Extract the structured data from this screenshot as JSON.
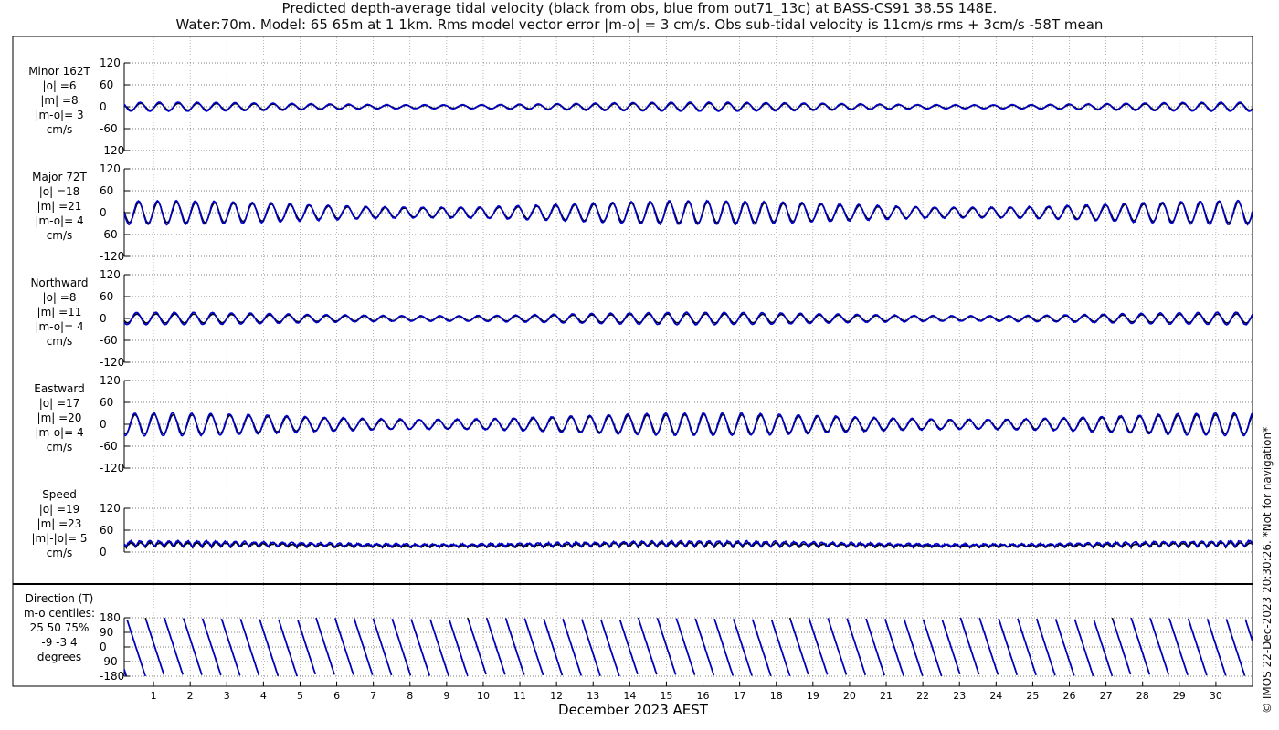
{
  "title": {
    "line1": "Predicted depth-average tidal velocity (black from obs, blue from out71_13c) at BASS-CS91 38.5S 148E.",
    "line2": "Water:70m. Model: 65 65m at 1 1km. Rms model vector error |m-o| = 3 cm/s. Obs sub-tidal velocity is 11cm/s rms + 3cm/s -58T mean"
  },
  "credit": "© IMOS 22-Dec-2023 20:30:26. *Not for navigation*",
  "colors": {
    "obs": "#000000",
    "model": "#0000cc",
    "grid": "#888888"
  },
  "chart_data": {
    "type": "line",
    "xlabel": "December 2023 AEST",
    "x_ticks": [
      "1",
      "2",
      "3",
      "4",
      "5",
      "6",
      "7",
      "8",
      "9",
      "10",
      "11",
      "12",
      "13",
      "14",
      "15",
      "16",
      "17",
      "18",
      "19",
      "20",
      "21",
      "22",
      "23",
      "24",
      "25",
      "26",
      "27",
      "28",
      "29",
      "30"
    ],
    "xlim_days": [
      0.2,
      31
    ],
    "series_names": [
      "obs",
      "model"
    ],
    "panels": [
      {
        "id": "minor",
        "label": [
          "Minor 162T",
          "|o| =6",
          "|m| =8",
          "|m-o|= 3",
          "cm/s"
        ],
        "ylim": [
          -120,
          120
        ],
        "yticks": [
          120,
          60,
          0,
          -60,
          -120
        ],
        "obs_amplitude": 6,
        "model_amplitude": 8,
        "mean": 0,
        "kind": "tide"
      },
      {
        "id": "major",
        "label": [
          "Major 72T",
          "|o| =18",
          "|m| =21",
          "|m-o|= 4",
          "cm/s"
        ],
        "ylim": [
          -120,
          120
        ],
        "yticks": [
          120,
          60,
          0,
          -60,
          -120
        ],
        "obs_amplitude": 18,
        "model_amplitude": 21,
        "mean": 0,
        "kind": "tide"
      },
      {
        "id": "north",
        "label": [
          "Northward",
          "|o| =8",
          "|m| =11",
          "|m-o|= 4",
          "cm/s"
        ],
        "ylim": [
          -120,
          120
        ],
        "yticks": [
          120,
          60,
          0,
          -60,
          -120
        ],
        "obs_amplitude": 8,
        "model_amplitude": 11,
        "mean": 0,
        "kind": "tide"
      },
      {
        "id": "east",
        "label": [
          "Eastward",
          "|o| =17",
          "|m| =20",
          "|m-o|= 4",
          "cm/s"
        ],
        "ylim": [
          -120,
          120
        ],
        "yticks": [
          120,
          60,
          0,
          -60,
          -120
        ],
        "obs_amplitude": 17,
        "model_amplitude": 20,
        "mean": 0,
        "kind": "tide"
      },
      {
        "id": "speed",
        "label": [
          "Speed",
          "|o| =19",
          "|m| =23",
          "|m|-|o|= 5",
          "cm/s"
        ],
        "ylim": [
          0,
          120
        ],
        "yticks": [
          120,
          60,
          0
        ],
        "obs_amplitude": 19,
        "model_amplitude": 23,
        "mean": 20,
        "kind": "speed"
      },
      {
        "id": "direction",
        "label": [
          "Direction (T)",
          "m-o centiles:",
          "25  50  75%",
          "-9 -3  4",
          "degrees"
        ],
        "ylim": [
          -180,
          180
        ],
        "yticks": [
          180,
          90,
          0,
          -90,
          -180
        ],
        "kind": "direction"
      }
    ]
  }
}
